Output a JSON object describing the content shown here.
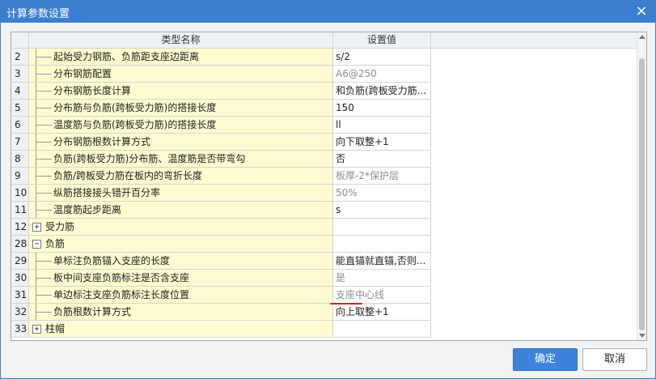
{
  "window": {
    "title": "计算参数设置",
    "close_glyph": "×"
  },
  "table": {
    "headers": {
      "name": "类型名称",
      "value": "设置值"
    },
    "rows": [
      {
        "num": "2",
        "name": "起始受力钢筋、负筋距支座边距离",
        "value": "s/2",
        "dim": false,
        "kind": "child"
      },
      {
        "num": "3",
        "name": "分布钢筋配置",
        "value": "A6@250",
        "dim": true,
        "kind": "child"
      },
      {
        "num": "4",
        "name": "分布钢筋长度计算",
        "value": "和负筋(跨板受力筋...",
        "dim": false,
        "kind": "child"
      },
      {
        "num": "5",
        "name": "分布筋与负筋(跨板受力筋)的搭接长度",
        "value": "150",
        "dim": false,
        "kind": "child"
      },
      {
        "num": "6",
        "name": "温度筋与负筋(跨板受力筋)的搭接长度",
        "value": "ll",
        "dim": false,
        "kind": "child"
      },
      {
        "num": "7",
        "name": "分布钢筋根数计算方式",
        "value": "向下取整+1",
        "dim": false,
        "kind": "child"
      },
      {
        "num": "8",
        "name": "负筋(跨板受力筋)分布筋、温度筋是否带弯勾",
        "value": "否",
        "dim": false,
        "kind": "child"
      },
      {
        "num": "9",
        "name": "负筋/跨板受力筋在板内的弯折长度",
        "value": "板厚-2*保护层",
        "dim": true,
        "kind": "child"
      },
      {
        "num": "10",
        "name": "纵筋搭接接头错开百分率",
        "value": "50%",
        "dim": true,
        "kind": "child"
      },
      {
        "num": "11",
        "name": "温度筋起步距离",
        "value": "s",
        "dim": false,
        "kind": "child"
      },
      {
        "num": "12",
        "name": "受力筋",
        "value": "",
        "dim": false,
        "kind": "group",
        "toggle": "+"
      },
      {
        "num": "28",
        "name": "负筋",
        "value": "",
        "dim": false,
        "kind": "group",
        "toggle": "−"
      },
      {
        "num": "29",
        "name": "单标注负筋锚入支座的长度",
        "value": "能直锚就直锚,否则...",
        "dim": false,
        "kind": "child"
      },
      {
        "num": "30",
        "name": "板中间支座负筋标注是否含支座",
        "value": "是",
        "dim": true,
        "kind": "child"
      },
      {
        "num": "31",
        "name": "单边标注支座负筋标注长度位置",
        "value": "支座中心线",
        "dim": true,
        "kind": "child"
      },
      {
        "num": "32",
        "name": "负筋根数计算方式",
        "value": "向上取整+1",
        "dim": false,
        "kind": "child"
      },
      {
        "num": "33",
        "name": "柱帽",
        "value": "",
        "dim": false,
        "kind": "group",
        "toggle": "+"
      }
    ]
  },
  "buttons": {
    "ok": "确定",
    "cancel": "取消"
  },
  "colors": {
    "titlebar": "#3c7fd1",
    "name_cell_bg": "#fffbd0",
    "primary_button": "#3c83db",
    "annotation_underline": "#e02020"
  }
}
